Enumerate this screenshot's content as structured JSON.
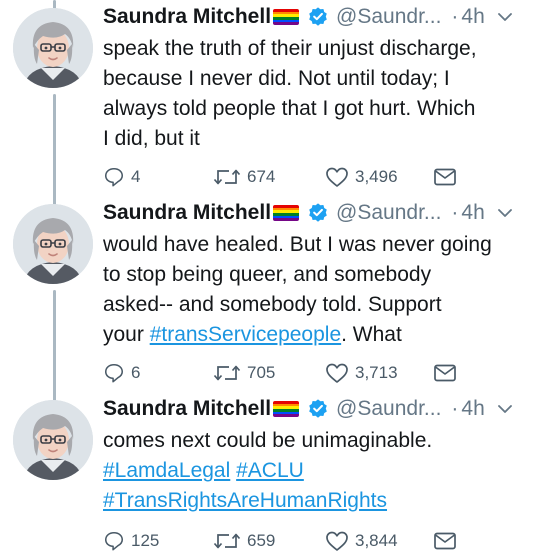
{
  "tweets": [
    {
      "name": "Saundra Mitchell",
      "handle": "@Saundr...",
      "dot": "·",
      "time": "4h",
      "lines": [
        {
          "text": "speak the truth of their unjust discharge,"
        },
        {
          "text": "because I never did. Not until today; I"
        },
        {
          "text": "always told people that I got hurt. Which"
        },
        {
          "text": "I did, but it"
        }
      ],
      "replies": "4",
      "retweets": "674",
      "likes": "3,496"
    },
    {
      "name": "Saundra Mitchell",
      "handle": "@Saundr...",
      "dot": "·",
      "time": "4h",
      "lines": [
        {
          "text": "would have healed. But I was never going"
        },
        {
          "text": "to stop being queer, and somebody"
        },
        {
          "text": "asked-- and somebody told. Support"
        },
        {
          "pre": "your ",
          "link": "#transServicepeople",
          "post": ". What"
        }
      ],
      "replies": "6",
      "retweets": "705",
      "likes": "3,713"
    },
    {
      "name": "Saundra Mitchell",
      "handle": "@Saundr...",
      "dot": "·",
      "time": "4h",
      "lines": [
        {
          "text": "comes next could be unimaginable."
        },
        {
          "link": "#LamdaLegal",
          "mid": " ",
          "link2": "#ACLU"
        },
        {
          "link": "#TransRightsAreHumanRights"
        }
      ],
      "replies": "125",
      "retweets": "659",
      "likes": "3,844"
    }
  ],
  "icons": {
    "verified": "verified-badge-icon",
    "flag": "rainbow-flag-icon",
    "chevron": "chevron-down-icon",
    "reply": "reply-icon",
    "retweet": "retweet-icon",
    "like": "heart-icon",
    "dm": "direct-message-icon"
  },
  "colors": {
    "link": "#1b95e0",
    "verified": "#1da1f2",
    "muted": "#657786",
    "thread_line": "#aab8c2"
  }
}
